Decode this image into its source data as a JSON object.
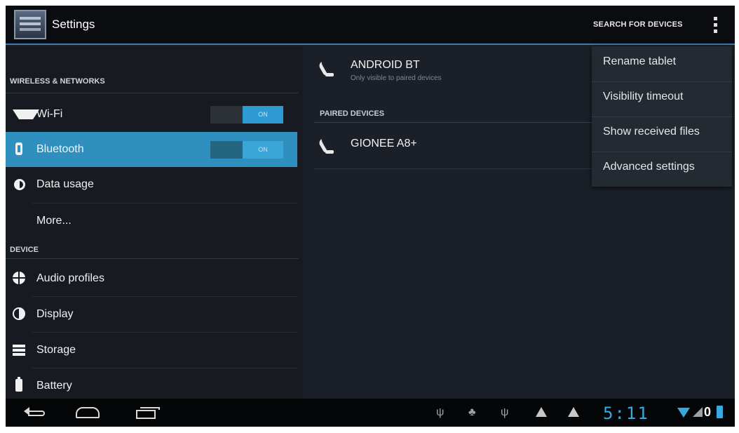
{
  "action_bar": {
    "title": "Settings",
    "search_label": "SEARCH FOR DEVICES",
    "overflow_icon": "overflow-menu-icon"
  },
  "sidebar": {
    "sections": [
      {
        "header": "WIRELESS & NETWORKS"
      },
      {
        "header": "DEVICE"
      }
    ],
    "items": [
      {
        "label": "Wi-Fi",
        "icon": "wifi-icon",
        "toggle": "ON",
        "selected": false
      },
      {
        "label": "Bluetooth",
        "icon": "bluetooth-icon",
        "toggle": "ON",
        "selected": true
      },
      {
        "label": "Data usage",
        "icon": "data-usage-icon"
      },
      {
        "label": "More..."
      },
      {
        "label": "Audio profiles",
        "icon": "audio-profiles-icon"
      },
      {
        "label": "Display",
        "icon": "display-icon"
      },
      {
        "label": "Storage",
        "icon": "storage-icon"
      },
      {
        "label": "Battery",
        "icon": "battery-icon"
      }
    ]
  },
  "bluetooth": {
    "device_name": "ANDROID BT",
    "device_sub": "Only visible to paired devices",
    "paired_header": "PAIRED DEVICES",
    "paired": [
      {
        "name": "GIONEE A8+"
      }
    ]
  },
  "menu": {
    "items": [
      {
        "label": "Rename tablet"
      },
      {
        "label": "Visibility timeout"
      },
      {
        "label": "Show received files"
      },
      {
        "label": "Advanced settings"
      }
    ]
  },
  "status_bar": {
    "clock": "5:11",
    "battery_text": "0"
  },
  "colors": {
    "accent": "#2f8fbf",
    "clock": "#37a8e0",
    "background": "#1c2026"
  }
}
